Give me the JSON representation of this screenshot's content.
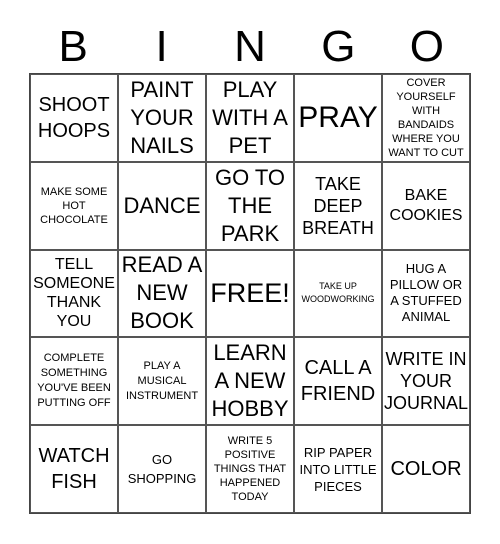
{
  "header": {
    "letters": [
      "B",
      "I",
      "N",
      "G",
      "O"
    ]
  },
  "rows": [
    [
      "SHOOT HOOPS",
      "PAINT YOUR NAILS",
      "PLAY WITH A PET",
      "PRAY",
      "COVER YOURSELF WITH BANDAIDS WHERE YOU WANT TO CUT"
    ],
    [
      "MAKE SOME HOT CHOCOLATE",
      "DANCE",
      "GO TO THE PARK",
      "TAKE DEEP BREATH",
      "BAKE COOKIES"
    ],
    [
      "TELL SOMEONE THANK YOU",
      "READ A NEW BOOK",
      "FREE!",
      "TAKE UP WOODWORKING",
      "HUG A PILLOW OR A STUFFED ANIMAL"
    ],
    [
      "COMPLETE SOMETHING YOU'VE BEEN PUTTING OFF",
      "PLAY A MUSICAL INSTRUMENT",
      "LEARN A NEW HOBBY",
      "CALL A FRIEND",
      "WRITE IN YOUR JOURNAL"
    ],
    [
      "WATCH FISH",
      "GO SHOPPING",
      "WRITE 5 POSITIVE THINGS THAT HAPPENED TODAY",
      "RIP PAPER INTO LITTLE PIECES",
      "COLOR"
    ]
  ]
}
